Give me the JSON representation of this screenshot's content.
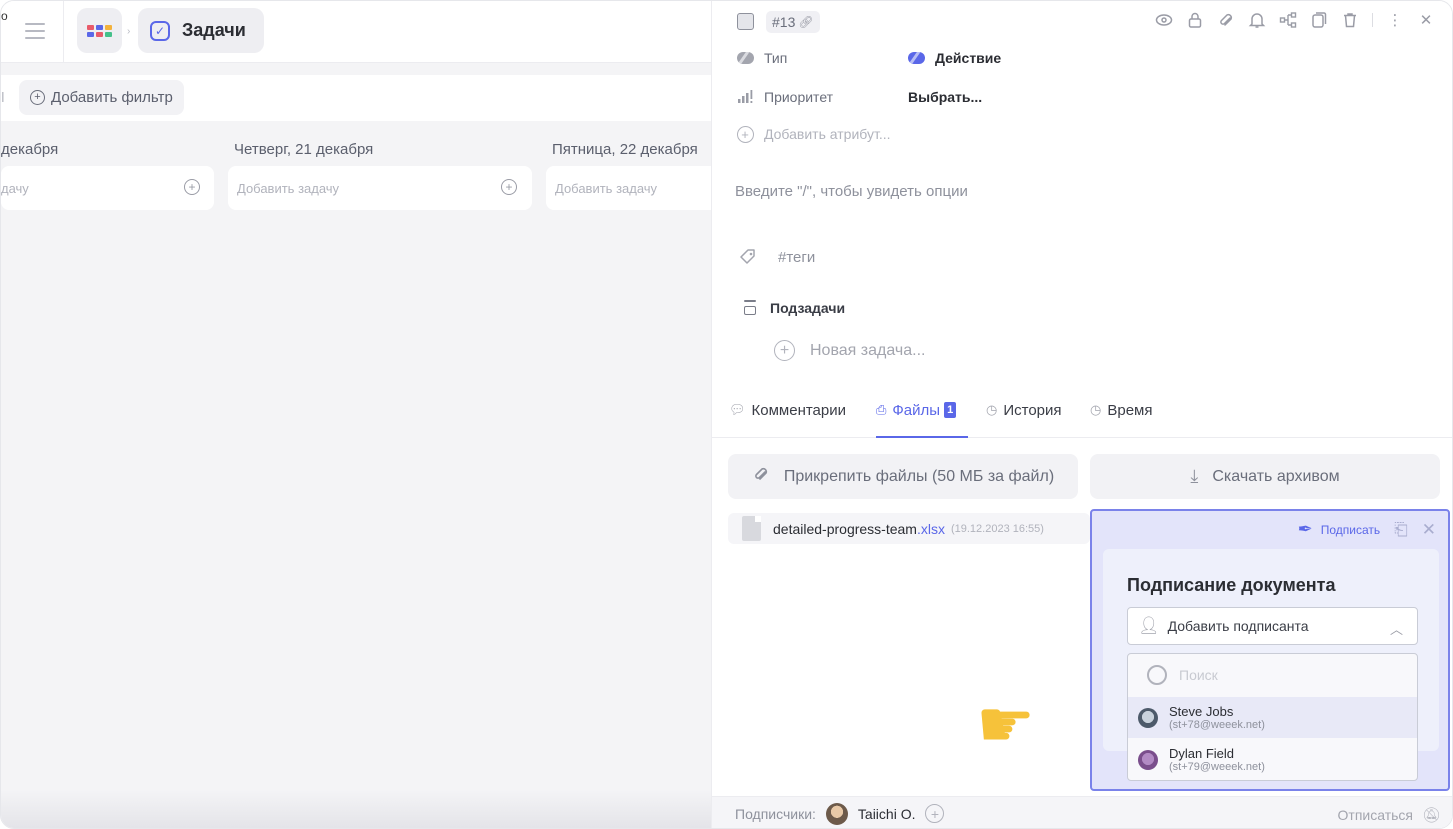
{
  "topbar": {
    "cut_char": "о",
    "crumb_sep": "›",
    "tasks_label": "Задачи"
  },
  "filterbar": {
    "add_filter": "Добавить фильтр"
  },
  "board": {
    "columns": [
      {
        "title": "декабря",
        "add_task": "дачу"
      },
      {
        "title": "Четверг, 21 декабря",
        "add_task": "Добавить задачу"
      },
      {
        "title": "Пятница, 22 декабря",
        "add_task": "Добавить задачу"
      }
    ]
  },
  "task": {
    "id": "#13",
    "attributes": {
      "type_label": "Тип",
      "type_value": "Действие",
      "priority_label": "Приоритет",
      "priority_value": "Выбрать...",
      "add_attribute": "Добавить атрибут..."
    },
    "editor_hint": "Введите \"/\", чтобы увидеть опции",
    "tags_placeholder": "#теги",
    "subtasks_title": "Подзадачи",
    "new_subtask": "Новая задача..."
  },
  "tabs": {
    "comments": "Комментарии",
    "files": "Файлы",
    "files_count": "1",
    "history": "История",
    "time": "Время"
  },
  "files": {
    "attach_button": "Прикрепить файлы (50 МБ за файл)",
    "download_button": "Скачать архивом",
    "items": [
      {
        "name": "detailed-progress-team",
        "ext": ".xlsx",
        "date": "(19.12.2023 16:55)"
      }
    ]
  },
  "signing": {
    "sign_link": "Подписать",
    "title": "Подписание документа",
    "add_signer": "Добавить подписанта",
    "search_placeholder": "Поиск",
    "users": [
      {
        "name": "Steve Jobs",
        "email": "(st+78@weeek.net)"
      },
      {
        "name": "Dylan Field",
        "email": "(st+79@weeek.net)"
      }
    ]
  },
  "footer": {
    "subscribers_label": "Подписчики:",
    "subscriber_name": "Taiichi O.",
    "unsubscribe": "Отписаться"
  },
  "icons": {
    "pointer": "backhand-index-pointing-right"
  },
  "colors": {
    "accent": "#5a67e8",
    "sign_panel_bg": "#e3e4fa",
    "sign_panel_border": "#7a82ea"
  }
}
